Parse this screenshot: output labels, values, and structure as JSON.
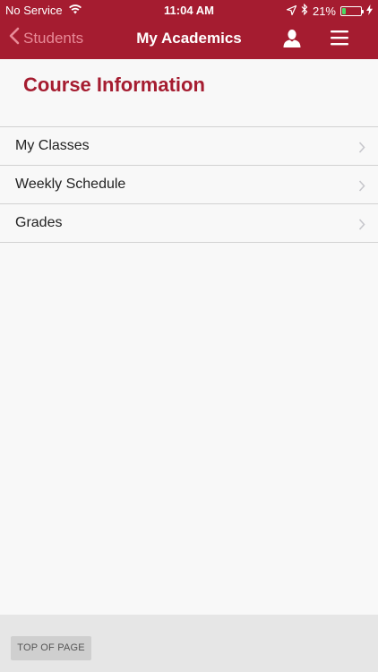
{
  "status_bar": {
    "carrier": "No Service",
    "time": "11:04 AM",
    "battery_percent": "21%",
    "battery_level": 0.21,
    "icons": [
      "wifi-icon",
      "location-arrow-icon",
      "bluetooth-icon",
      "battery-icon",
      "charging-bolt-icon"
    ]
  },
  "nav": {
    "back_label": "Students",
    "title": "My Academics",
    "icons": [
      "chevron-left-icon",
      "user-icon",
      "hamburger-menu-icon"
    ]
  },
  "section": {
    "title": "Course Information"
  },
  "list": {
    "items": [
      {
        "label": "My Classes"
      },
      {
        "label": "Weekly Schedule"
      },
      {
        "label": "Grades"
      }
    ]
  },
  "footer": {
    "top_of_page_label": "TOP OF PAGE"
  },
  "colors": {
    "brand": "#a51c30",
    "back_text": "#e88a97",
    "battery": "#4cd964"
  }
}
